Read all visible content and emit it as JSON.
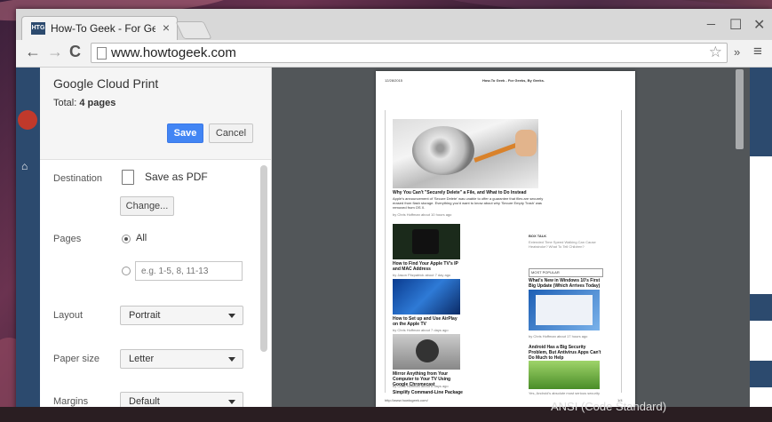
{
  "browser": {
    "tab_title": "How-To Geek - For Geeks, I",
    "favicon_text": "HTG",
    "url": "www.howtogeek.com",
    "window_controls": {
      "minimize": "_",
      "maximize": "☐",
      "close": "✕"
    },
    "nav": {
      "back": "←",
      "forward": "→",
      "reload": "C"
    },
    "toolbar_right": {
      "star": "☆",
      "extensions": "»",
      "menu": "≡"
    }
  },
  "print_dialog": {
    "title": "Google Cloud Print",
    "total_label": "Total:",
    "total_value": "4 pages",
    "save_label": "Save",
    "cancel_label": "Cancel",
    "destination": {
      "label": "Destination",
      "value": "Save as PDF",
      "change_label": "Change..."
    },
    "pages": {
      "label": "Pages",
      "all_label": "All",
      "all_selected": true,
      "custom_placeholder": "e.g. 1-5, 8, 11-13"
    },
    "layout": {
      "label": "Layout",
      "value": "Portrait"
    },
    "paper_size": {
      "label": "Paper size",
      "value": "Letter"
    },
    "margins": {
      "label": "Margins",
      "value": "Default"
    }
  },
  "preview": {
    "header_left": "12/28/2015",
    "header_right": "How-To Geek - For Geeks, By Geeks.",
    "main_title": "Why You Can't \"Securely Delete\" a File, and What to Do Instead",
    "main_body": "Apple's announcement of 'Secure Delete' was unable to offer a guarantee that files are securely erased from flash storage. Everything you'd want to know about why 'Secure Empty Trash' was removed from OS X.",
    "main_meta": "by Chris Hoffman about 10 hours ago",
    "articles": [
      {
        "title": "How to Find Your Apple TV's IP and MAC Address",
        "meta": "by Jason Fitzpatrick about 7 day ago"
      },
      {
        "title": "How to Set up and Use AirPlay on the Apple TV",
        "meta": "by Chris Hoffman about 7 days ago"
      },
      {
        "title": "Mirror Anything from Your Computer to Your TV Using Google Chromecast",
        "meta": "by Chris Hoffman about 8 days ago"
      },
      {
        "title": "Simplify Command-Line Package",
        "meta": ""
      }
    ],
    "sidebar_heading": "BOX TALK",
    "sidebar_snippet": "Extended Time Speed Walking Can Cause Heatstroke? What To Tell Children?",
    "sidebar_box_title": "MOST POPULAR",
    "sidebar_articles": [
      {
        "title": "What's New in Windows 10's First Big Update (Which Arrives Today)",
        "meta": "by Chris Hoffman about 17 hours ago"
      },
      {
        "title": "Android Has a Big Security Problem, But Antivirus Apps Can't Do Much to Help",
        "meta": "Yes, Android's absolute most serious security"
      }
    ],
    "footer_url": "http://www.howtogeek.com/",
    "footer_page": "1/4"
  },
  "background_text": "ANSI (Code Standard)",
  "colors": {
    "save_blue": "#4285f4",
    "site_navy": "#2c4a6e",
    "preview_bg": "#525659"
  }
}
